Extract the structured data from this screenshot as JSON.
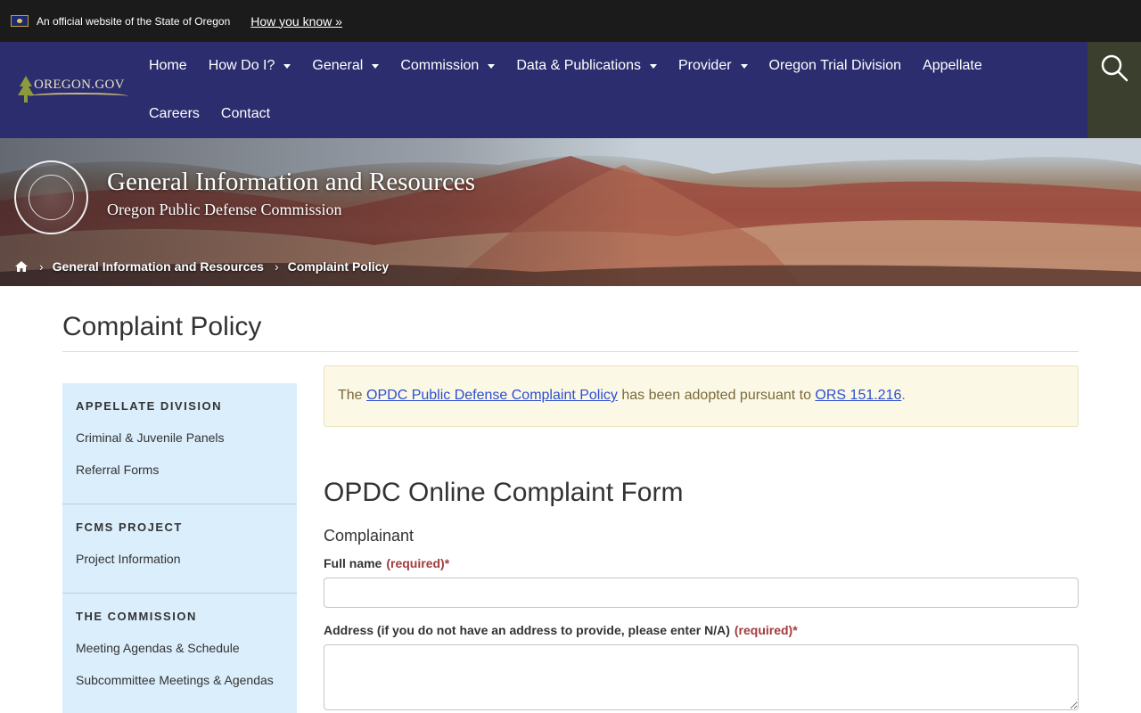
{
  "official": {
    "text": "An official website of the State of Oregon",
    "how_link": "How you know »"
  },
  "nav": {
    "logo_text": "OREGON.GOV",
    "row1": [
      {
        "label": "Home",
        "dropdown": false
      },
      {
        "label": "How Do I?",
        "dropdown": true
      },
      {
        "label": "General",
        "dropdown": true
      },
      {
        "label": "Commission",
        "dropdown": true
      },
      {
        "label": "Data & Publications",
        "dropdown": true
      },
      {
        "label": "Provider",
        "dropdown": true
      },
      {
        "label": "Oregon Trial Division",
        "dropdown": false
      },
      {
        "label": "Appellate",
        "dropdown": false
      }
    ],
    "row2": [
      {
        "label": "Careers",
        "dropdown": false
      },
      {
        "label": "Contact",
        "dropdown": false
      }
    ],
    "search_icon": "search-icon"
  },
  "hero": {
    "title": "General Information and Resources",
    "subtitle": "Oregon Public Defense Commission",
    "breadcrumb": [
      "General Information and Resources",
      "Complaint Policy"
    ]
  },
  "page": {
    "title": "Complaint Policy"
  },
  "sidebar": [
    {
      "heading": "APPELLATE DIVISION",
      "links": [
        "Criminal & Juvenile Panels",
        "Referral Forms"
      ]
    },
    {
      "heading": "FCMS PROJECT",
      "links": [
        "Project Information"
      ]
    },
    {
      "heading": "THE COMMISSION",
      "links": [
        "Meeting Agendas & Schedule",
        "Subcommittee Meetings & Agendas"
      ]
    }
  ],
  "notice": {
    "prefix": "The ",
    "link1": "OPDC Public Defense Complaint Policy",
    "middle": " has been adopted pursuant to ",
    "link2": "ORS 151.216",
    "suffix": "."
  },
  "form": {
    "title": "OPDC Online Complaint Form",
    "section": "Complainant",
    "fields": [
      {
        "label": "Full name",
        "required": "(required)*",
        "value": ""
      },
      {
        "label": "Address (if you do not have an address to provide, please enter N/A)",
        "required": "(required)*",
        "value": ""
      }
    ]
  },
  "colors": {
    "nav_bg": "#2b2d6e",
    "official_bg": "#1b1b1b",
    "sidebar_bg": "#dbeefc",
    "notice_bg": "#fcf8e6",
    "required": "#a33b3b",
    "link": "#2a4fd1"
  }
}
